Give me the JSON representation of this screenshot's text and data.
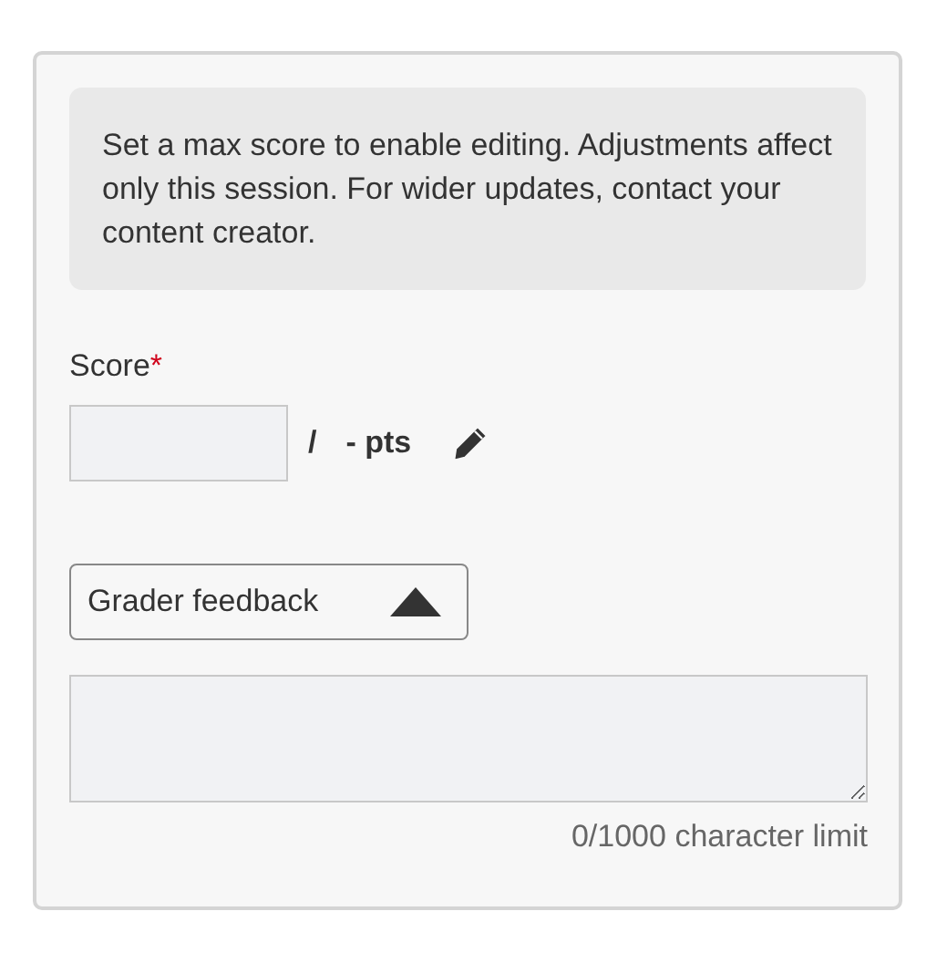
{
  "notice": "Set a max score to enable editing. Adjustments affect only this session. For wider updates, contact your content creator.",
  "score": {
    "label": "Score",
    "required_mark": "*",
    "separator": "/",
    "points": "- pts"
  },
  "feedback": {
    "label": "Grader feedback",
    "expanded": true,
    "character_limit": "0/1000 character limit"
  }
}
